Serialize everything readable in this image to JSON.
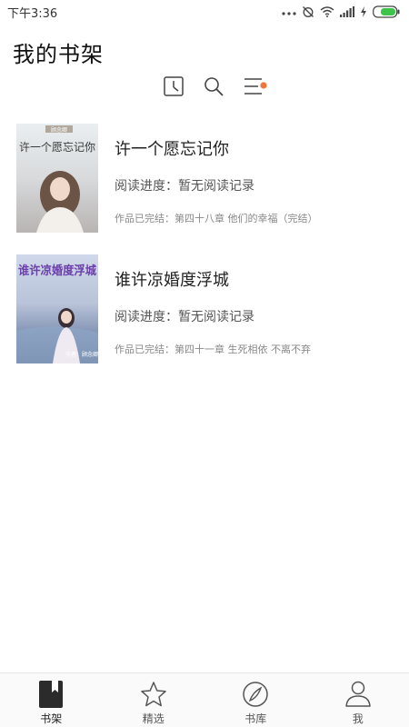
{
  "status_bar": {
    "time": "下午3:36",
    "icons": [
      "more-dots-icon",
      "alarm-off-icon",
      "wifi-icon",
      "signal-icon",
      "charging-icon",
      "battery-icon"
    ],
    "battery_color": "#3ec24a"
  },
  "header": {
    "title": "我的书架"
  },
  "toolbar": {
    "icons": [
      "history-icon",
      "search-icon",
      "menu-icon"
    ],
    "badge_color": "#f0743b"
  },
  "books": [
    {
      "title": "许一个愿忘记你",
      "progress": "阅读进度：暂无阅读记录",
      "latest_chapter": "作品已完结：第四十八章 他们的幸福（完结）",
      "cover_text": "许一个愿忘记你",
      "cover_tag": "顾念卿"
    },
    {
      "title": "谁许凉婚度浮城",
      "progress": "阅读进度：暂无阅读记录",
      "latest_chapter": "作品已完结：第四十一章 生死相依 不离不弃",
      "cover_text": "谁许凉婚度浮城",
      "cover_tag": "作者：顾念卿"
    }
  ],
  "tab_bar": {
    "tabs": [
      {
        "label": "书架",
        "icon": "bookshelf-icon",
        "active": true
      },
      {
        "label": "精选",
        "icon": "star-icon",
        "active": false
      },
      {
        "label": "书库",
        "icon": "compass-icon",
        "active": false
      },
      {
        "label": "我",
        "icon": "user-icon",
        "active": false
      }
    ]
  }
}
